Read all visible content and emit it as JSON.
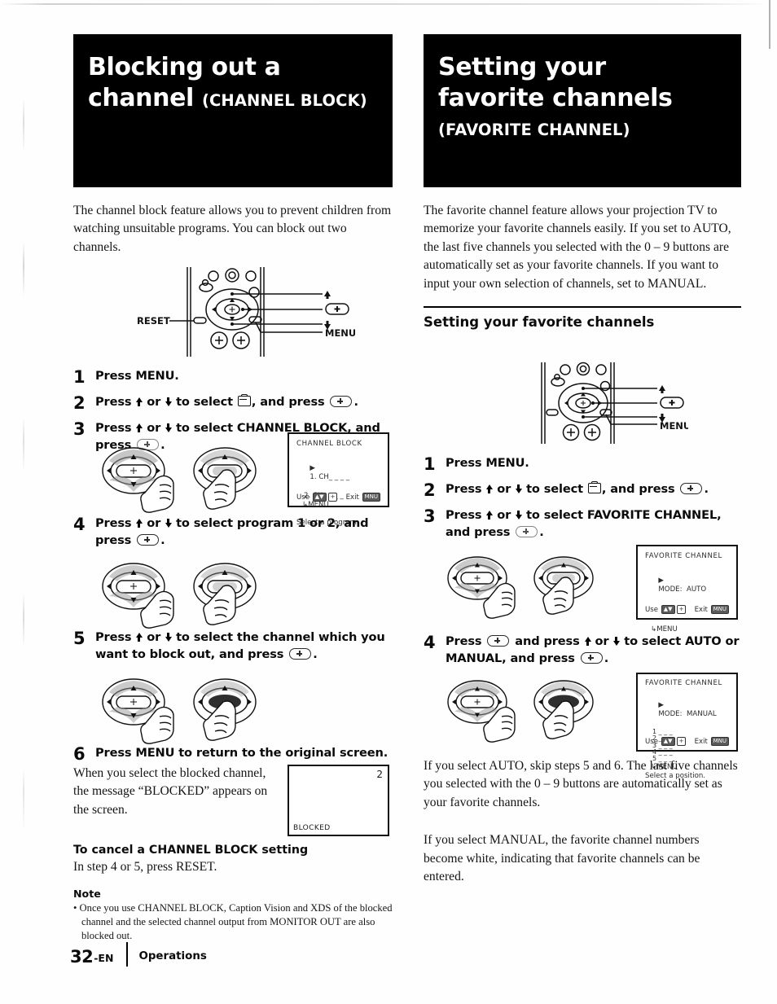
{
  "page": {
    "number": "32",
    "lang_suffix": "-EN",
    "section": "Operations"
  },
  "left_column": {
    "banner": {
      "title_line1": "Blocking out a",
      "title_line2": "channel",
      "title_suffix": "(CHANNEL BLOCK)"
    },
    "intro": "The channel block feature allows you to prevent children from watching unsuitable programs. You can block out two channels.",
    "remote_labels": {
      "reset": "RESET",
      "menu": "MENU"
    },
    "steps": [
      {
        "num": "1",
        "text_before": "Press MENU."
      },
      {
        "num": "2",
        "text_a": "Press ",
        "text_b": " or ",
        "text_c": " to select ",
        "text_d": ", and press ",
        "text_e": "."
      },
      {
        "num": "3",
        "text_a": "Press ",
        "text_b": " or ",
        "text_c": " to select CHANNEL BLOCK, and press ",
        "text_d": "."
      },
      {
        "num": "4",
        "text_a": "Press ",
        "text_b": " or ",
        "text_c": " to select program 1 or 2, and press ",
        "text_d": "."
      },
      {
        "num": "5",
        "text_a": "Press ",
        "text_b": " or ",
        "text_c": " to select the channel which you want to block out, and press ",
        "text_d": "."
      },
      {
        "num": "6",
        "text_a": "Press MENU to return to the original screen."
      }
    ],
    "step6_body": "When you select the blocked channel, the message “BLOCKED” appears on the screen.",
    "osd_channel_block": {
      "title": "CHANNEL BLOCK",
      "row1": "1. CH_ _ _ _",
      "row2": "2. CH_ _ _ _",
      "row3": "MENU",
      "hint": "Select a program",
      "use_label": "Use",
      "exit_label": "Exit"
    },
    "blocked_screen": {
      "channel_number": "2",
      "message": "BLOCKED"
    },
    "cancel_heading": "To cancel a CHANNEL BLOCK setting",
    "cancel_body": "In step 4 or 5, press RESET.",
    "note_heading": "Note",
    "note_bullet": "• Once you use CHANNEL BLOCK, Caption Vision and XDS of the blocked channel and the selected channel output from MONITOR OUT are also blocked out."
  },
  "right_column": {
    "banner": {
      "title_line1": "Setting your",
      "title_line2": "favorite channels",
      "subtitle": "(FAVORITE CHANNEL)"
    },
    "intro": "The favorite channel feature allows your projection TV to memorize your favorite channels easily. If you set to AUTO, the last five channels you selected with the 0 – 9 buttons are automatically set as your favorite channels. If you want to input your own selection of channels, set to MANUAL.",
    "section_heading": "Setting your favorite channels",
    "remote_labels": {
      "menu": "MENU"
    },
    "steps": [
      {
        "num": "1",
        "text_before": "Press MENU."
      },
      {
        "num": "2",
        "text_a": "Press ",
        "text_b": " or ",
        "text_c": " to select ",
        "text_d": ", and press ",
        "text_e": "."
      },
      {
        "num": "3",
        "text_a": "Press ",
        "text_b": " or ",
        "text_c": " to select FAVORITE CHANNEL, and press ",
        "text_d": "."
      },
      {
        "num": "4",
        "text_a": "Press ",
        "text_b": " and press ",
        "text_c": " or ",
        "text_d": " to select AUTO or MANUAL, and press ",
        "text_e": "."
      }
    ],
    "osd_favorite_auto": {
      "title": "FAVORITE CHANNEL",
      "mode_row": "MODE:  AUTO",
      "menu_row": "MENU",
      "use_label": "Use",
      "exit_label": "Exit"
    },
    "osd_favorite_manual": {
      "title": "FAVORITE CHANNEL",
      "mode_row": "MODE:  MANUAL",
      "slots": [
        "1 _ _ _",
        "2 _ _ _",
        "3 _ _ _",
        "4 _ _ _",
        "5 _ _ _"
      ],
      "menu_row": "MENU",
      "hint": "Select a position.",
      "use_label": "Use",
      "exit_label": "Exit"
    },
    "closing_para_1": "If you select AUTO, skip steps 5 and 6. The last five channels you selected with the 0 – 9 buttons are automatically set as your favorite channels.",
    "closing_para_2": "If you select MANUAL, the favorite channel numbers become white, indicating that favorite channels can be entered."
  },
  "colors": {
    "banner_bg": "#000000",
    "banner_fg": "#ffffff",
    "ink": "#111111",
    "paper": "#fefefe"
  }
}
